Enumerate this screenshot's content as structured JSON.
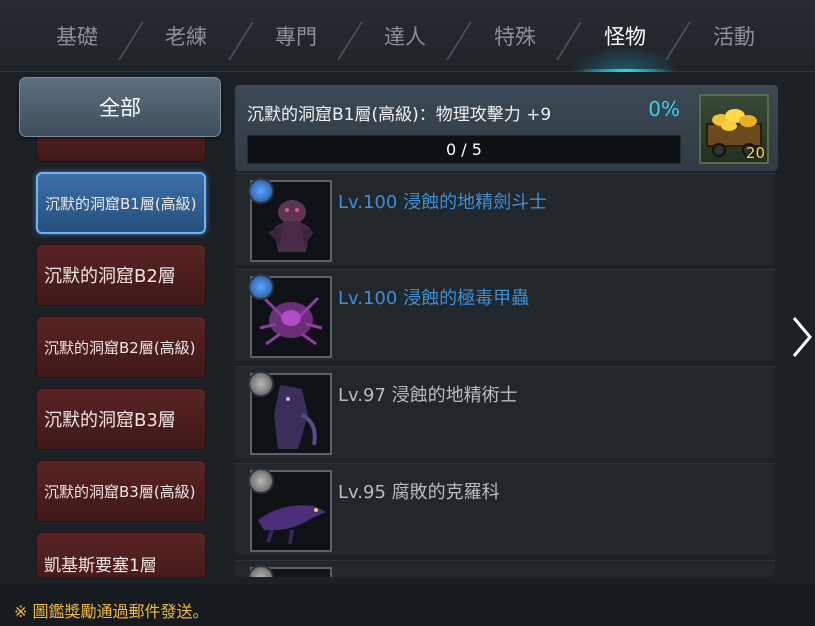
{
  "tabs": [
    {
      "label": "基礎",
      "active": false
    },
    {
      "label": "老練",
      "active": false
    },
    {
      "label": "專門",
      "active": false
    },
    {
      "label": "達人",
      "active": false
    },
    {
      "label": "特殊",
      "active": false
    },
    {
      "label": "怪物",
      "active": true
    },
    {
      "label": "活動",
      "active": false
    }
  ],
  "sidebar": {
    "all_label": "全部",
    "zones": [
      {
        "label": "",
        "state": "partial"
      },
      {
        "label": "沉默的洞窟B1層(高級)",
        "state": "selected"
      },
      {
        "label": "沉默的洞窟B2層",
        "state": "normal"
      },
      {
        "label": "沉默的洞窟B2層(高級)",
        "state": "normal"
      },
      {
        "label": "沉默的洞窟B3層",
        "state": "normal"
      },
      {
        "label": "沉默的洞窟B3層(高級)",
        "state": "normal"
      },
      {
        "label": "凱基斯要塞1層",
        "state": "normal"
      }
    ]
  },
  "quest": {
    "title": "沉默的洞窟B1層(高級)：物理攻擊力 +9",
    "percent": "0%",
    "progress_text": "0 / 5",
    "progress_value": 0,
    "reward_icon": "gold-cart-icon",
    "reward_qty": "20"
  },
  "monsters": [
    {
      "name": "Lv.100 浸蝕的地精劍斗士",
      "badge": "blue",
      "icon": "goblin-gladiator-icon",
      "color": "#3d8fd6"
    },
    {
      "name": "Lv.100 浸蝕的極毒甲蟲",
      "badge": "blue",
      "icon": "poison-beetle-icon",
      "color": "#3d8fd6"
    },
    {
      "name": "Lv.97 浸蝕的地精術士",
      "badge": "gray",
      "icon": "goblin-mage-icon",
      "color": "#b8bcbf"
    },
    {
      "name": "Lv.95 腐敗的克羅科",
      "badge": "gray",
      "icon": "croco-icon",
      "color": "#b8bcbf"
    },
    {
      "name": "",
      "badge": "gray",
      "icon": "monster-icon",
      "color": "#b8bcbf"
    }
  ],
  "footer": {
    "notice": "※ 圖鑑獎勵通過郵件發送。"
  },
  "colors": {
    "accent": "#34d8ee",
    "notice": "#f0b93a",
    "zone_bg": "#4a1f1f",
    "zone_selected": "#2f5f93"
  }
}
